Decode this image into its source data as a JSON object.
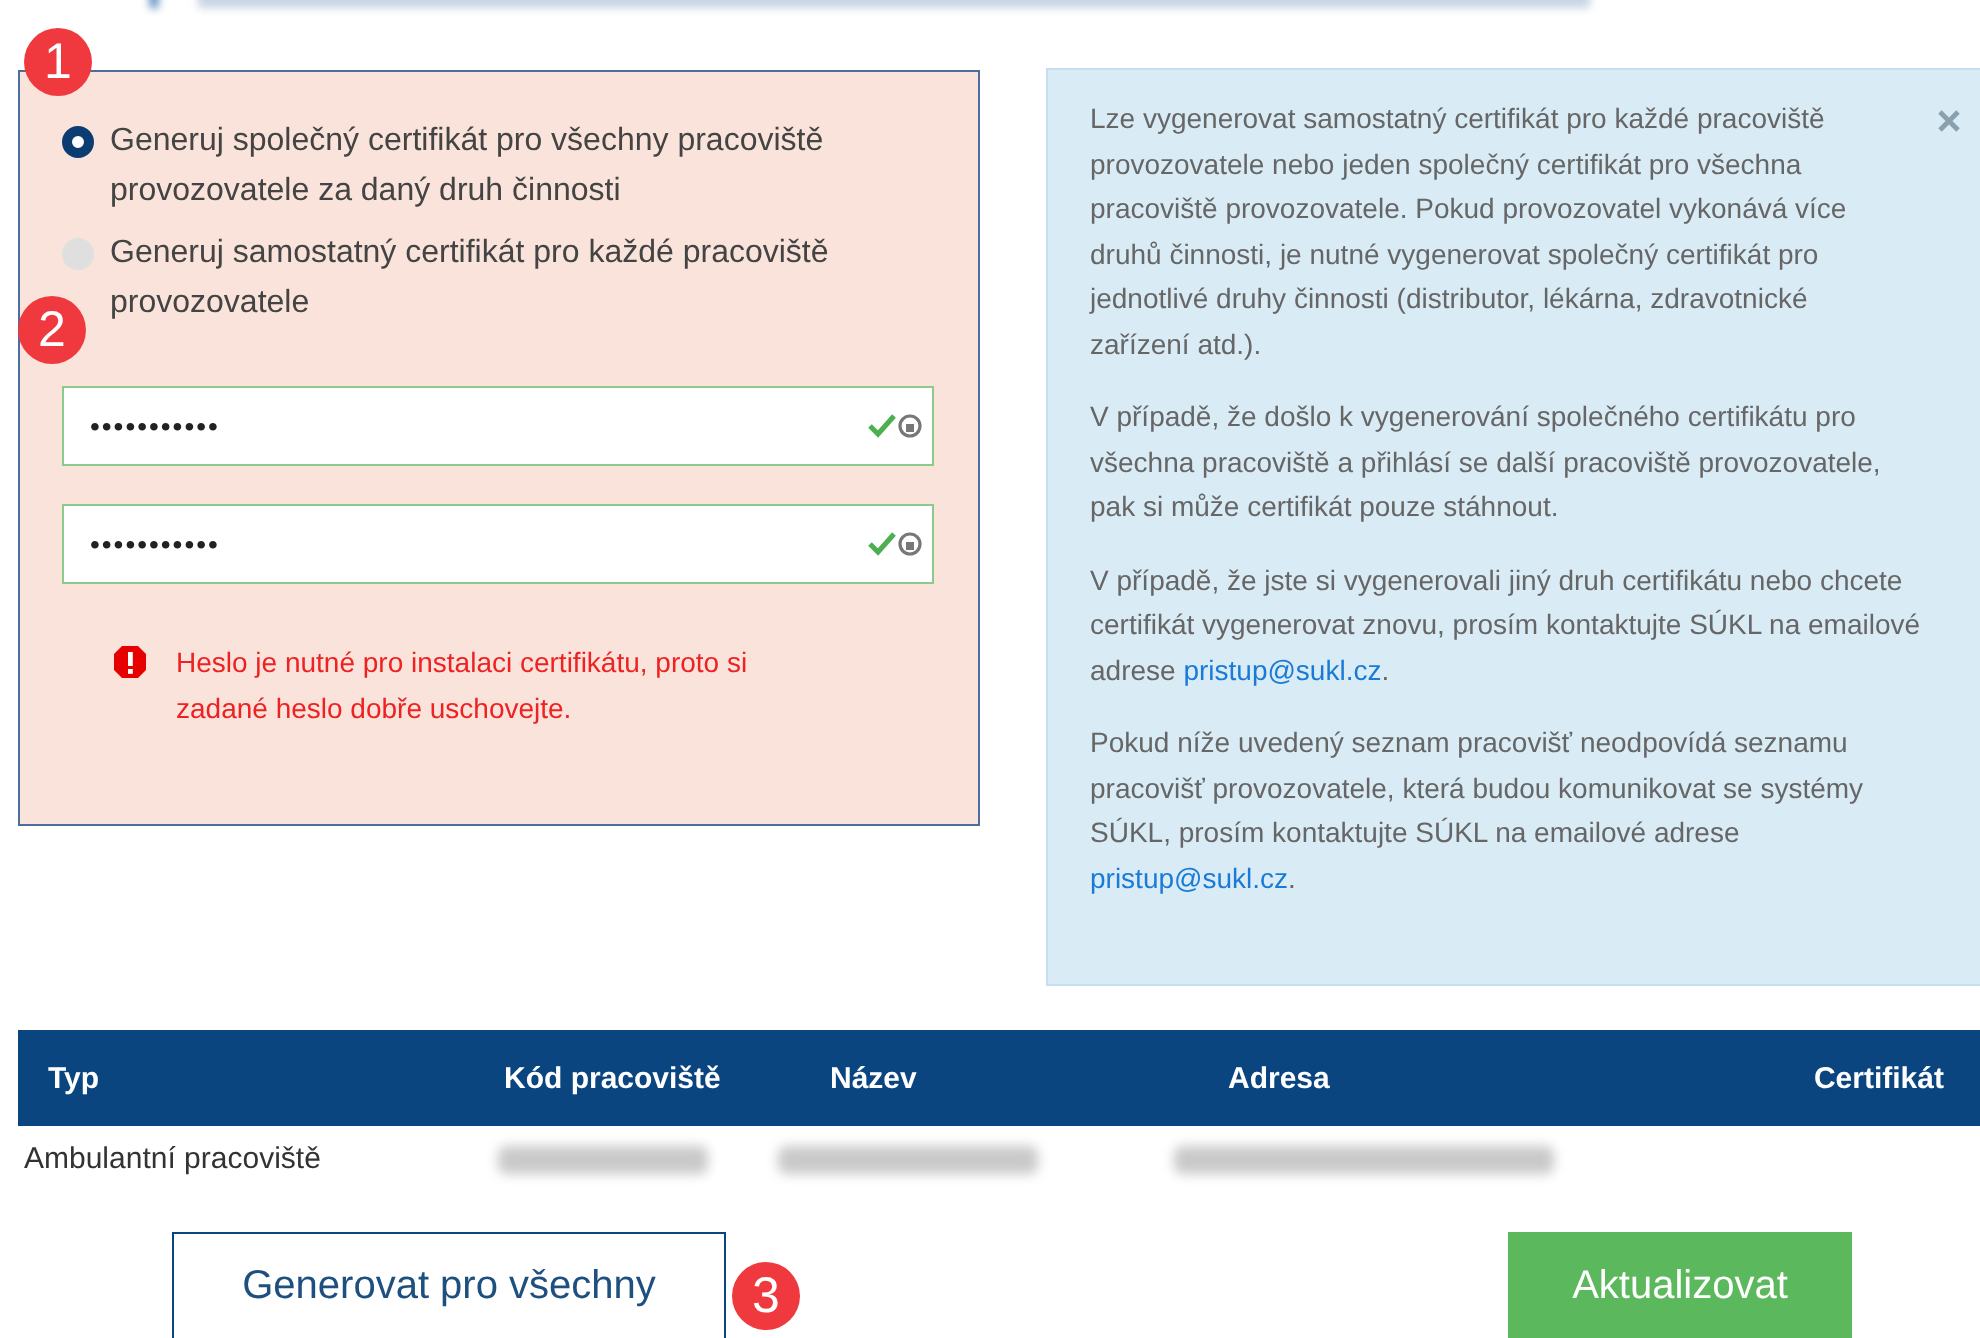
{
  "certificate_form": {
    "badge": "1",
    "options": [
      {
        "label": "Generuj společný certifikát pro všechny pracoviště provozovatele za daný druh činnosti",
        "selected": true
      },
      {
        "label": "Generuj samostatný certifikát pro každé pracoviště provozovatele",
        "selected": false
      }
    ],
    "password_badge": "2",
    "password_fields": [
      {
        "value": "•••••••••••",
        "valid": true
      },
      {
        "value": "•••••••••••",
        "valid": true
      }
    ],
    "warning": "Heslo je nutné pro instalaci certifikátu, proto si zadané heslo dobře uschovejte."
  },
  "info_box": {
    "paragraphs": [
      {
        "text": "Lze vygenerovat samostatný certifikát pro každé pracoviště provozovatele nebo jeden společný certifikát pro všechna pracoviště provozovatele. Pokud provozovatel vykonává více druhů činnosti, je nutné vygenerovat společný certifikát pro jednotlivé druhy činnosti (distributor, lékárna, zdravotnické zařízení atd.)."
      },
      {
        "text": "V případě, že došlo k vygenerování společného certifikátu pro všechna pracoviště a přihlásí se další pracoviště provozovatele, pak si může certifikát pouze stáhnout."
      },
      {
        "text": "V případě, že jste si vygenerovali jiný druh certifikátu nebo chcete certifikát vygenerovat znovu, prosím kontaktujte SÚKL na emailové adrese ",
        "link": "pristup@sukl.cz",
        "after": "."
      },
      {
        "text": "Pokud níže uvedený seznam pracovišť neodpovídá seznamu pracovišť provozovatele, která budou komunikovat se systémy SÚKL, prosím kontaktujte SÚKL na emailové adrese ",
        "link": "pristup@sukl.cz",
        "after": "."
      }
    ]
  },
  "table": {
    "columns": [
      "Typ",
      "Kód pracoviště",
      "Název",
      "Adresa",
      "Certifikát"
    ],
    "rows": [
      {
        "cells": [
          {
            "kind": "text",
            "text": "Ambulantní pracoviště"
          },
          {
            "kind": "redacted"
          },
          {
            "kind": "redacted"
          },
          {
            "kind": "redacted"
          }
        ]
      }
    ]
  },
  "actions": {
    "badge": "3",
    "buttons": [
      {
        "label": "Generovat pro všechny",
        "kind": "outline"
      },
      {
        "label": "Aktualizovat",
        "kind": "primary"
      }
    ]
  }
}
